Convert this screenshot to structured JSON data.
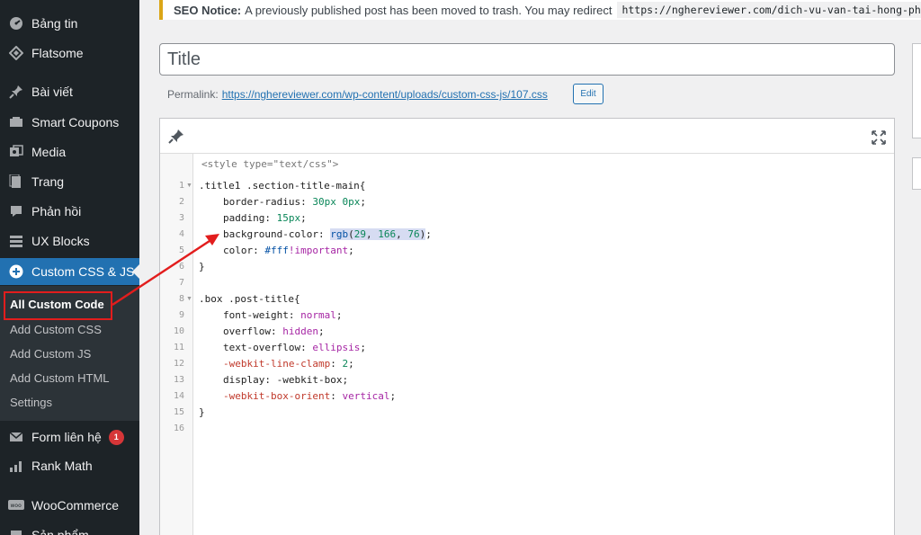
{
  "sidebar": {
    "items": [
      {
        "label": "Bảng tin",
        "icon": "dashboard-icon",
        "glyph": "◉"
      },
      {
        "label": "Flatsome",
        "icon": "flatsome-icon",
        "glyph": "◈"
      },
      {
        "label": "Bài viết",
        "icon": "pin-icon",
        "glyph": "📌"
      },
      {
        "label": "Smart Coupons",
        "icon": "coupon-icon",
        "glyph": "▦"
      },
      {
        "label": "Media",
        "icon": "media-icon",
        "glyph": "▣"
      },
      {
        "label": "Trang",
        "icon": "page-icon",
        "glyph": "▤"
      },
      {
        "label": "Phản hồi",
        "icon": "comment-icon",
        "glyph": "■"
      },
      {
        "label": "UX Blocks",
        "icon": "blocks-icon",
        "glyph": "▥"
      },
      {
        "label": "Custom CSS & JS",
        "icon": "plus-circle-icon",
        "glyph": "⊕"
      },
      {
        "label": "Form liên hệ",
        "icon": "mail-icon",
        "glyph": "✉",
        "badge": "1"
      },
      {
        "label": "Rank Math",
        "icon": "chart-icon",
        "glyph": "▟"
      },
      {
        "label": "WooCommerce",
        "icon": "woo-icon",
        "glyph": "▭"
      },
      {
        "label": "Sản phẩm",
        "icon": "product-icon",
        "glyph": "▢"
      }
    ],
    "submenu": [
      "All Custom Code",
      "Add Custom CSS",
      "Add Custom JS",
      "Add Custom HTML",
      "Settings"
    ]
  },
  "notice": {
    "label": "SEO Notice:",
    "text": "A previously published post has been moved to trash. You may redirect",
    "url": "https://nghereviewer.com/dich-vu-van-tai-hong-phat.h"
  },
  "editor": {
    "title_placeholder": "Title",
    "permalink_label": "Permalink:",
    "permalink_url": "https://nghereviewer.com/wp-content/uploads/custom-css-js/107.css",
    "edit_label": "Edit",
    "style_tag": "<style type=\"text/css\">",
    "line_numbers": [
      "1",
      "2",
      "3",
      "4",
      "5",
      "6",
      "7",
      "8",
      "9",
      "10",
      "11",
      "12",
      "13",
      "14",
      "15",
      "16"
    ]
  },
  "colors": {
    "sidebar_bg": "#1d2327",
    "active_blue": "#2271b1",
    "highlight_red": "#e21d1d",
    "notice_border": "#dba617"
  }
}
